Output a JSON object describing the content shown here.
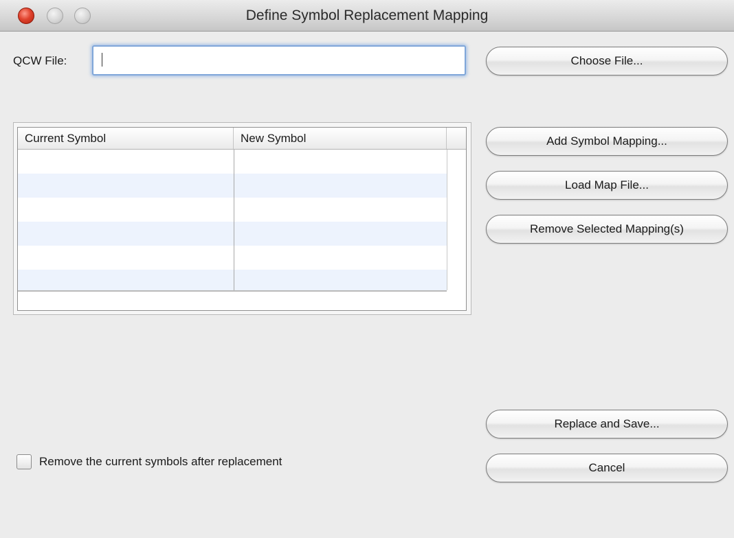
{
  "window": {
    "title": "Define Symbol Replacement Mapping"
  },
  "file_row": {
    "label": "QCW File:",
    "value": "",
    "choose_button": "Choose File..."
  },
  "table": {
    "columns": [
      "Current Symbol",
      "New Symbol"
    ],
    "rows": []
  },
  "side_buttons": {
    "add": "Add Symbol Mapping...",
    "load": "Load Map File...",
    "remove": "Remove Selected Mapping(s)"
  },
  "bottom_buttons": {
    "replace": "Replace and Save...",
    "cancel": "Cancel"
  },
  "checkbox": {
    "label": "Remove the current symbols after replacement",
    "checked": false
  },
  "colors": {
    "focus_ring": "#7fa6d9",
    "row_stripe": "#edf3fd",
    "close_button": "#e0432e"
  }
}
